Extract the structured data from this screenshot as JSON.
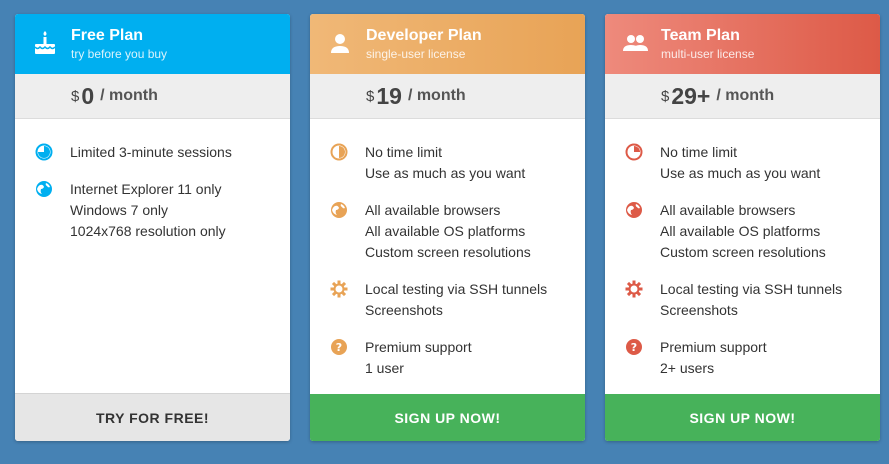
{
  "plans": [
    {
      "title": "Free Plan",
      "subtitle": "try before you buy",
      "currency": "$",
      "amount": "0",
      "period": "/ month",
      "features": [
        {
          "icon": "clock-icon",
          "lines": [
            "Limited 3-minute sessions"
          ]
        },
        {
          "icon": "globe-icon",
          "lines": [
            "Internet Explorer 11 only",
            "Windows 7 only",
            "1024x768 resolution only"
          ]
        }
      ],
      "cta": "TRY FOR FREE!"
    },
    {
      "title": "Developer Plan",
      "subtitle": "single-user license",
      "currency": "$",
      "amount": "19",
      "period": "/ month",
      "features": [
        {
          "icon": "clock-icon",
          "lines": [
            "No time limit",
            "Use as much as you want"
          ]
        },
        {
          "icon": "globe-icon",
          "lines": [
            "All available browsers",
            "All available OS platforms",
            "Custom screen resolutions"
          ]
        },
        {
          "icon": "gear-icon",
          "lines": [
            "Local testing via SSH tunnels",
            "Screenshots"
          ]
        },
        {
          "icon": "help-icon",
          "lines": [
            "Premium support",
            "1 user"
          ]
        }
      ],
      "cta": "SIGN UP NOW!"
    },
    {
      "title": "Team Plan",
      "subtitle": "multi-user license",
      "currency": "$",
      "amount": "29+",
      "period": "/ month",
      "features": [
        {
          "icon": "clock-icon",
          "lines": [
            "No time limit",
            "Use as much as you want"
          ]
        },
        {
          "icon": "globe-icon",
          "lines": [
            "All available browsers",
            "All available OS platforms",
            "Custom screen resolutions"
          ]
        },
        {
          "icon": "gear-icon",
          "lines": [
            "Local testing via SSH tunnels",
            "Screenshots"
          ]
        },
        {
          "icon": "help-icon",
          "lines": [
            "Premium support",
            "2+ users"
          ]
        }
      ],
      "cta": "SIGN UP NOW!"
    }
  ],
  "colors": {
    "background": "#4682b4",
    "free_accent": "#00aff0",
    "developer_accent": "#e8a356",
    "team_accent": "#dd5a47",
    "cta_green": "#47b25a"
  }
}
